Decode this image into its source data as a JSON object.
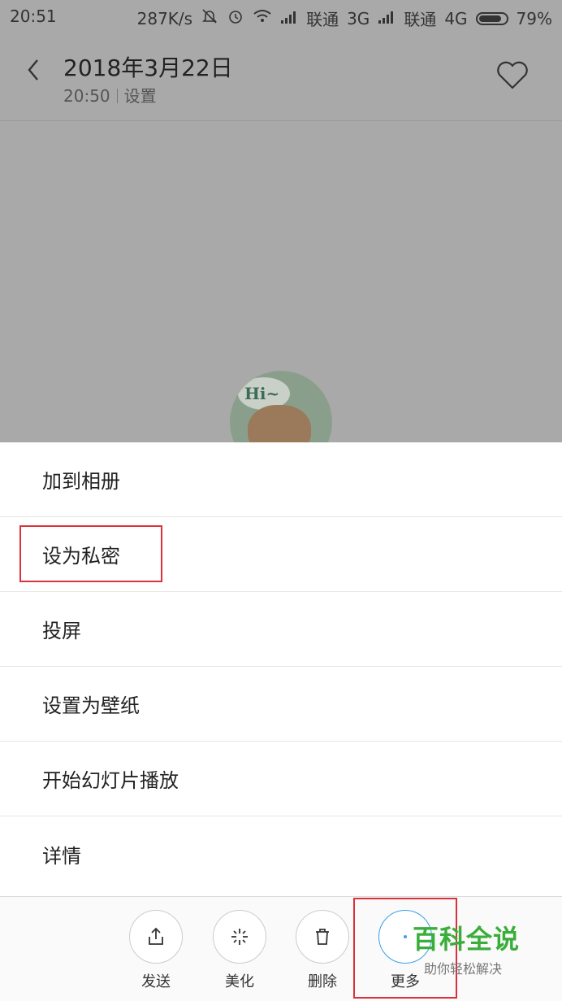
{
  "status_bar": {
    "time": "20:51",
    "speed": "287K/s",
    "carrier1": "联通",
    "net1": "3G",
    "carrier2": "联通",
    "net2": "4G",
    "battery": "79%"
  },
  "header": {
    "title": "2018年3月22日",
    "time": "20:50",
    "location": "设置"
  },
  "menu": {
    "items": [
      {
        "label": "加到相册"
      },
      {
        "label": "设为私密"
      },
      {
        "label": "投屏"
      },
      {
        "label": "设置为壁纸"
      },
      {
        "label": "开始幻灯片播放"
      },
      {
        "label": "详情"
      }
    ]
  },
  "toolbar": {
    "send_label": "发送",
    "beautify_label": "美化",
    "delete_label": "删除",
    "more_label": "更多"
  },
  "photo": {
    "avatar_text": "Hi~"
  },
  "watermark": {
    "main": "百科全说",
    "sub": "助你轻松解决"
  },
  "colors": {
    "highlight": "#d9323a",
    "watermark": "#3aae3a",
    "dim_overlay": "#a9a9a9"
  }
}
